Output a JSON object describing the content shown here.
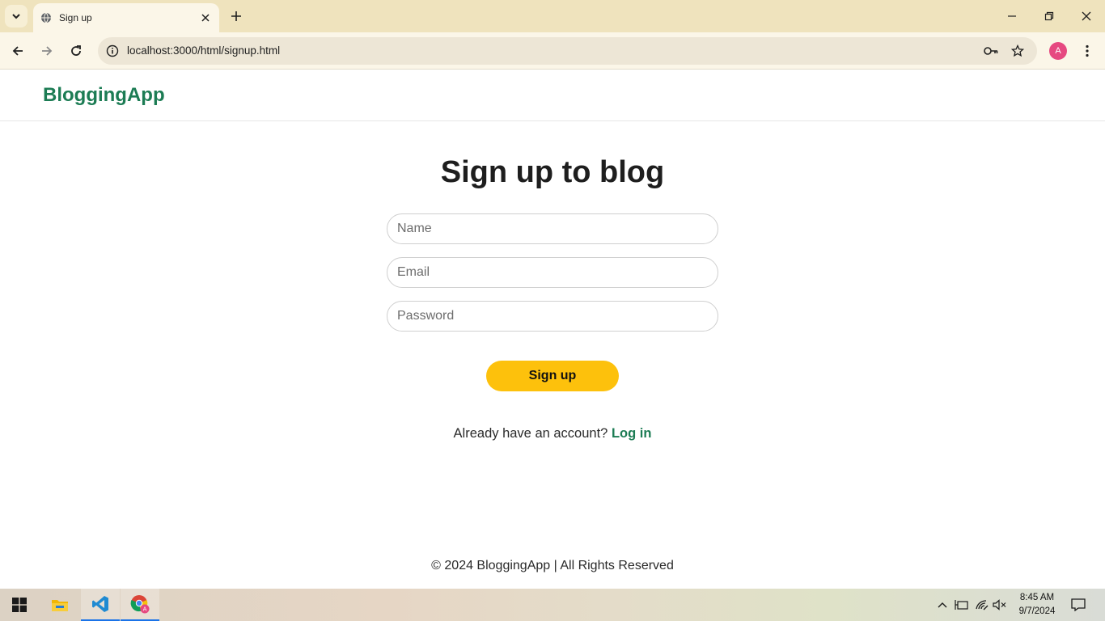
{
  "browser": {
    "tab_title": "Sign up",
    "url": "localhost:3000/html/signup.html",
    "profile_initial": "A"
  },
  "site": {
    "brand": "BloggingApp"
  },
  "form": {
    "title": "Sign up to blog",
    "name_placeholder": "Name",
    "email_placeholder": "Email",
    "password_placeholder": "Password",
    "submit_label": "Sign up",
    "login_prompt": "Already have an account?",
    "login_link": "Log in"
  },
  "footer": {
    "text": "© 2024 BloggingApp | All Rights Reserved"
  },
  "taskbar": {
    "time": "8:45 AM",
    "date": "9/7/2024"
  },
  "colors": {
    "brand_green": "#1c7c54",
    "button_yellow": "#fdc10c",
    "tabstrip": "#efe3bd"
  }
}
